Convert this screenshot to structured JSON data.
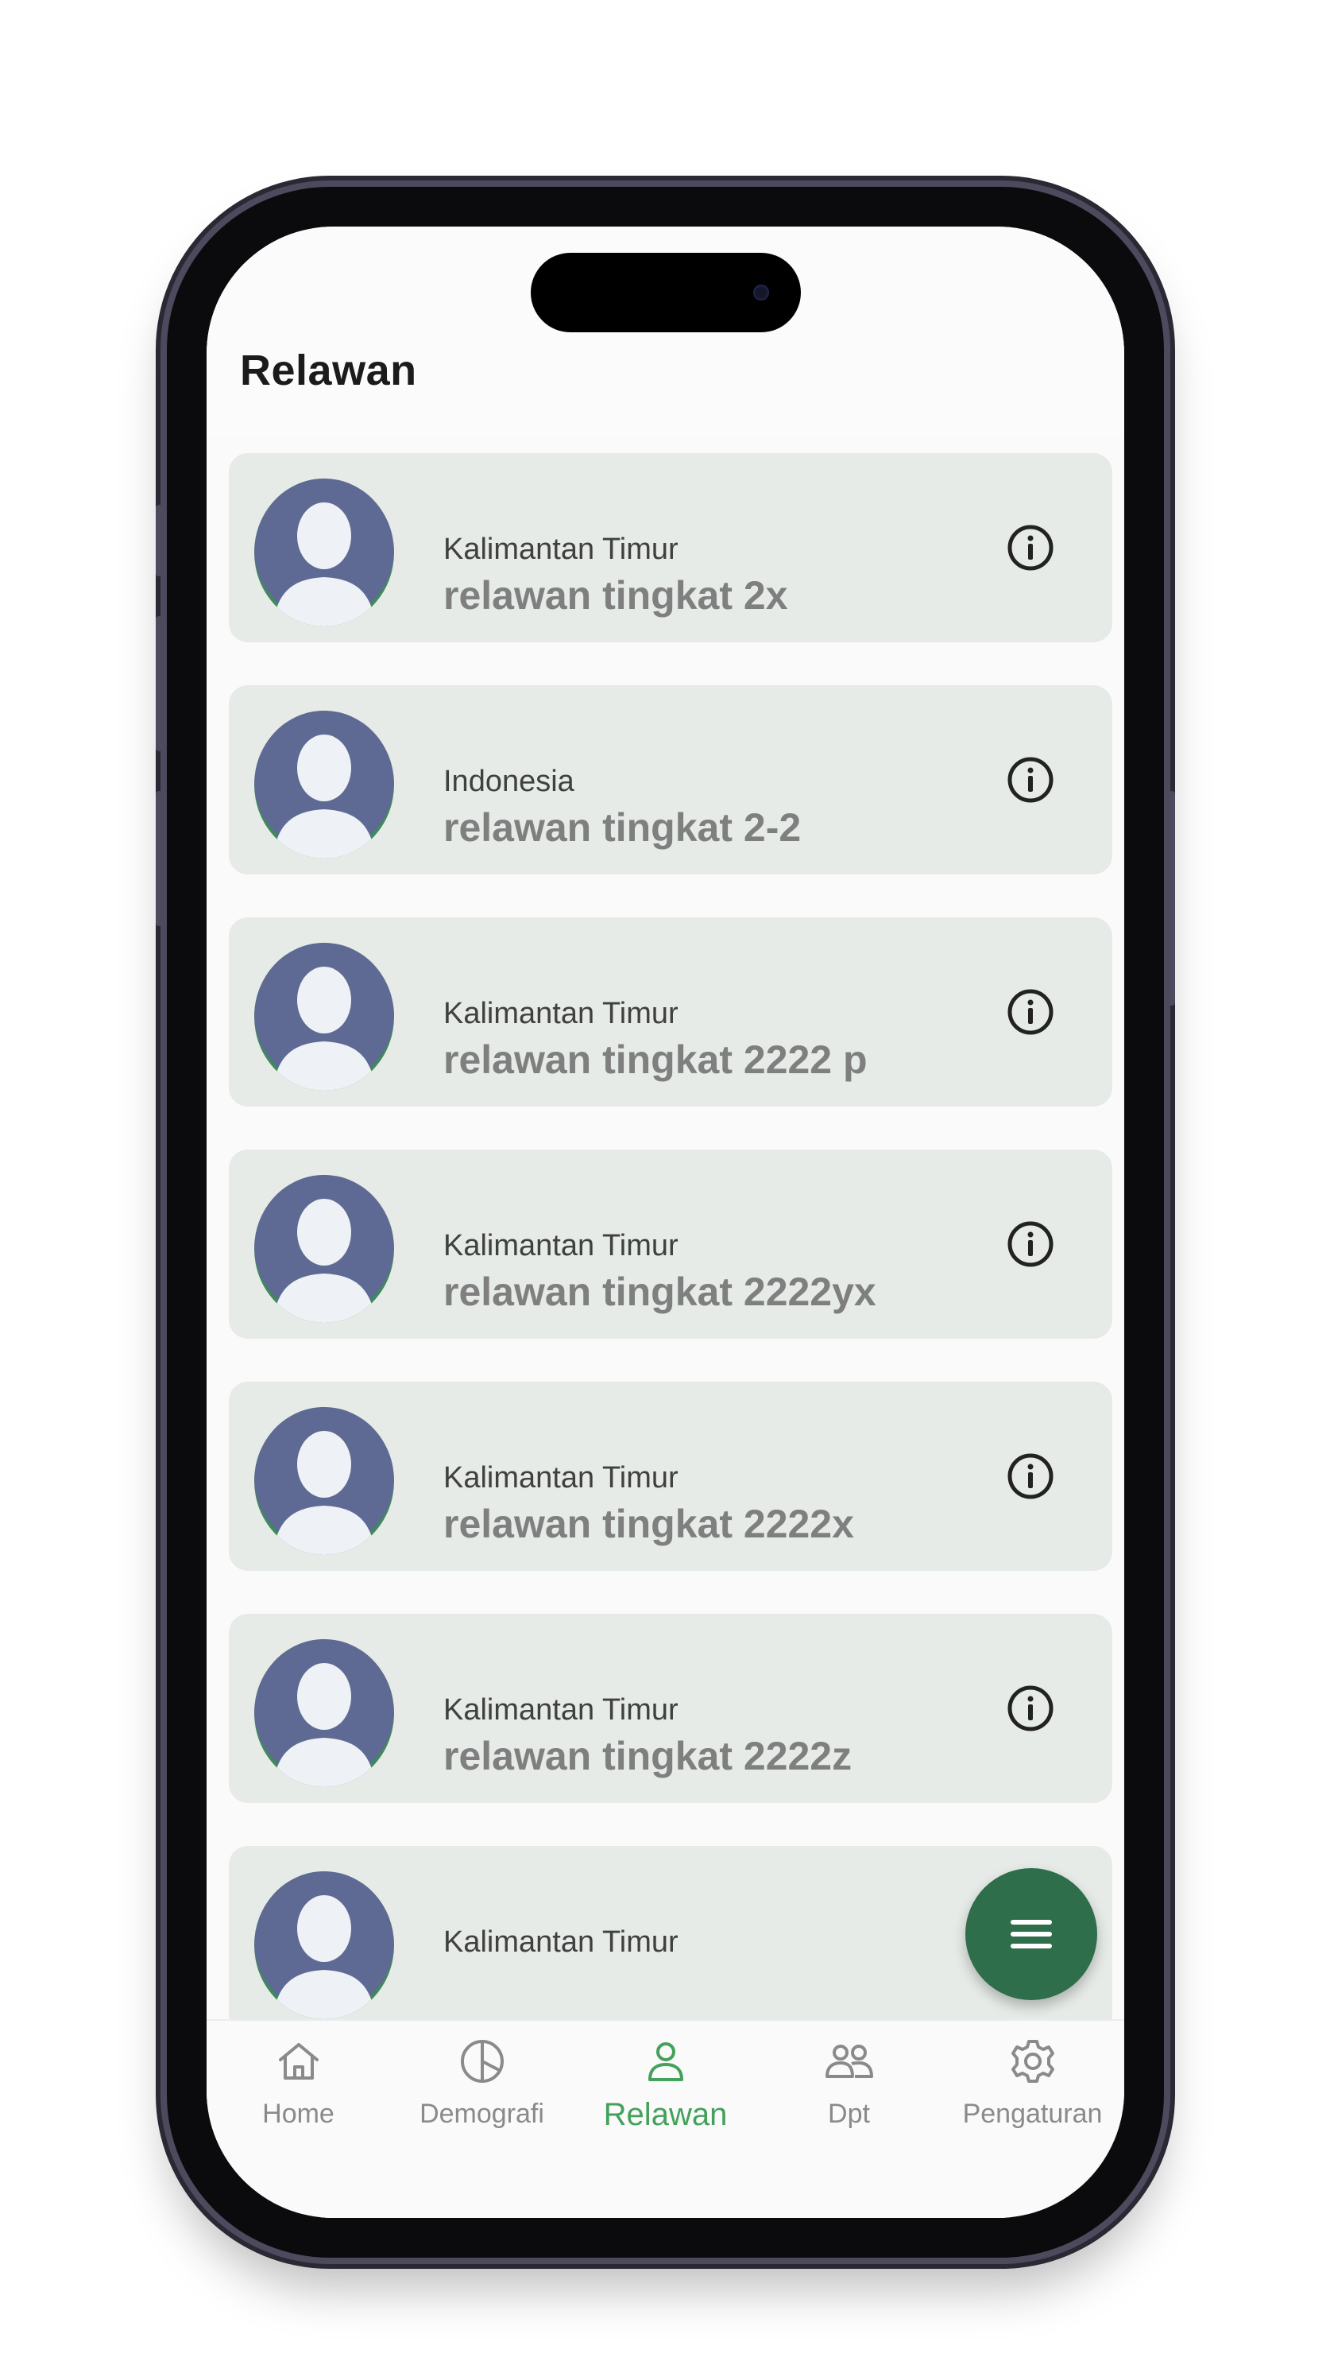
{
  "header": {
    "title": "Relawan"
  },
  "relawan_list": [
    {
      "region": "Kalimantan Timur",
      "name": "relawan tingkat 2x"
    },
    {
      "region": "Indonesia",
      "name": "relawan tingkat 2-2"
    },
    {
      "region": "Kalimantan Timur",
      "name": "relawan tingkat 2222 p"
    },
    {
      "region": "Kalimantan Timur",
      "name": "relawan tingkat 2222yx"
    },
    {
      "region": "Kalimantan Timur",
      "name": "relawan tingkat 2222x"
    },
    {
      "region": "Kalimantan Timur",
      "name": "relawan tingkat 2222z"
    },
    {
      "region": "Kalimantan Timur",
      "name": ""
    }
  ],
  "icons": {
    "avatar": "person-placeholder-icon",
    "info": "info-icon",
    "fab": "menu-icon"
  },
  "bottom_nav": {
    "active": "Relawan",
    "items": [
      {
        "label": "Home",
        "icon": "home-icon"
      },
      {
        "label": "Demografi",
        "icon": "pie-chart-icon"
      },
      {
        "label": "Relawan",
        "icon": "person-icon"
      },
      {
        "label": "Dpt",
        "icon": "people-icon"
      },
      {
        "label": "Pengaturan",
        "icon": "gear-icon"
      }
    ]
  },
  "colors": {
    "accent": "#43a15b",
    "fab": "#2e6e4b",
    "card_bg": "#e6ebe7",
    "avatar_bg": "#5e6a93"
  }
}
